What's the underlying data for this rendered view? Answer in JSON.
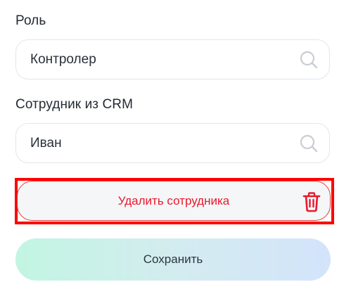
{
  "role": {
    "label": "Роль",
    "value": "Контролер",
    "icon": "search-icon"
  },
  "employee": {
    "label": "Сотрудник из CRM",
    "value": "Иван",
    "icon": "search-icon"
  },
  "delete_button": {
    "label": "Удалить сотрудника",
    "icon": "trash-icon",
    "color": "#e8192c"
  },
  "save_button": {
    "label": "Сохранить"
  },
  "highlight_color": "#ff0000"
}
